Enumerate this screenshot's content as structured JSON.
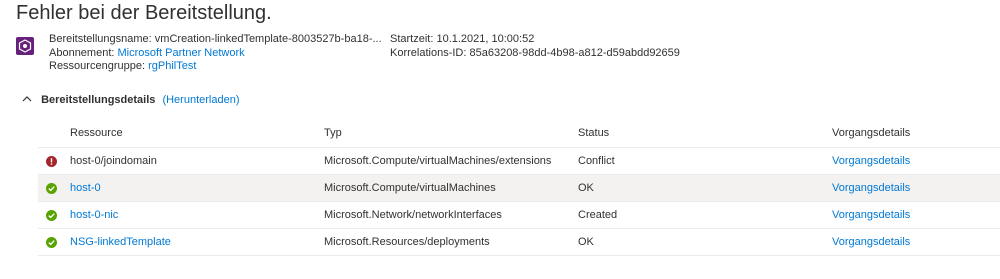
{
  "title": "Fehler bei der Bereitstellung.",
  "meta": {
    "deployment_name_label": "Bereitstellungsname:",
    "deployment_name_value": "vmCreation-linkedTemplate-8003527b-ba18-...",
    "subscription_label": "Abonnement:",
    "subscription_value": "Microsoft Partner Network",
    "resource_group_label": "Ressourcengruppe:",
    "resource_group_value": "rgPhilTest",
    "start_time_label": "Startzeit:",
    "start_time_value": "10.1.2021, 10:00:52",
    "correlation_label": "Korrelations-ID:",
    "correlation_value": "85a63208-98dd-4b98-a812-d59abdd92659"
  },
  "section": {
    "title": "Bereitstellungsdetails",
    "download_label": "(Herunterladen)"
  },
  "table": {
    "headers": [
      "Ressource",
      "Typ",
      "Status",
      "Vorgangsdetails"
    ],
    "rows": [
      {
        "status_icon": "error-icon",
        "resource": "host-0/joindomain",
        "type": "Microsoft.Compute/virtualMachines/extensions",
        "status": "Conflict",
        "details": "Vorgangsdetails"
      },
      {
        "status_icon": "success-icon",
        "resource": "host-0",
        "type": "Microsoft.Compute/virtualMachines",
        "status": "OK",
        "details": "Vorgangsdetails"
      },
      {
        "status_icon": "success-icon",
        "resource": "host-0-nic",
        "type": "Microsoft.Network/networkInterfaces",
        "status": "Created",
        "details": "Vorgangsdetails"
      },
      {
        "status_icon": "success-icon",
        "resource": "NSG-linkedTemplate",
        "type": "Microsoft.Resources/deployments",
        "status": "OK",
        "details": "Vorgangsdetails"
      }
    ]
  },
  "colors": {
    "link": "#0078d4",
    "error": "#a4262c",
    "success": "#57a300",
    "icon_bg": "#68217a"
  }
}
